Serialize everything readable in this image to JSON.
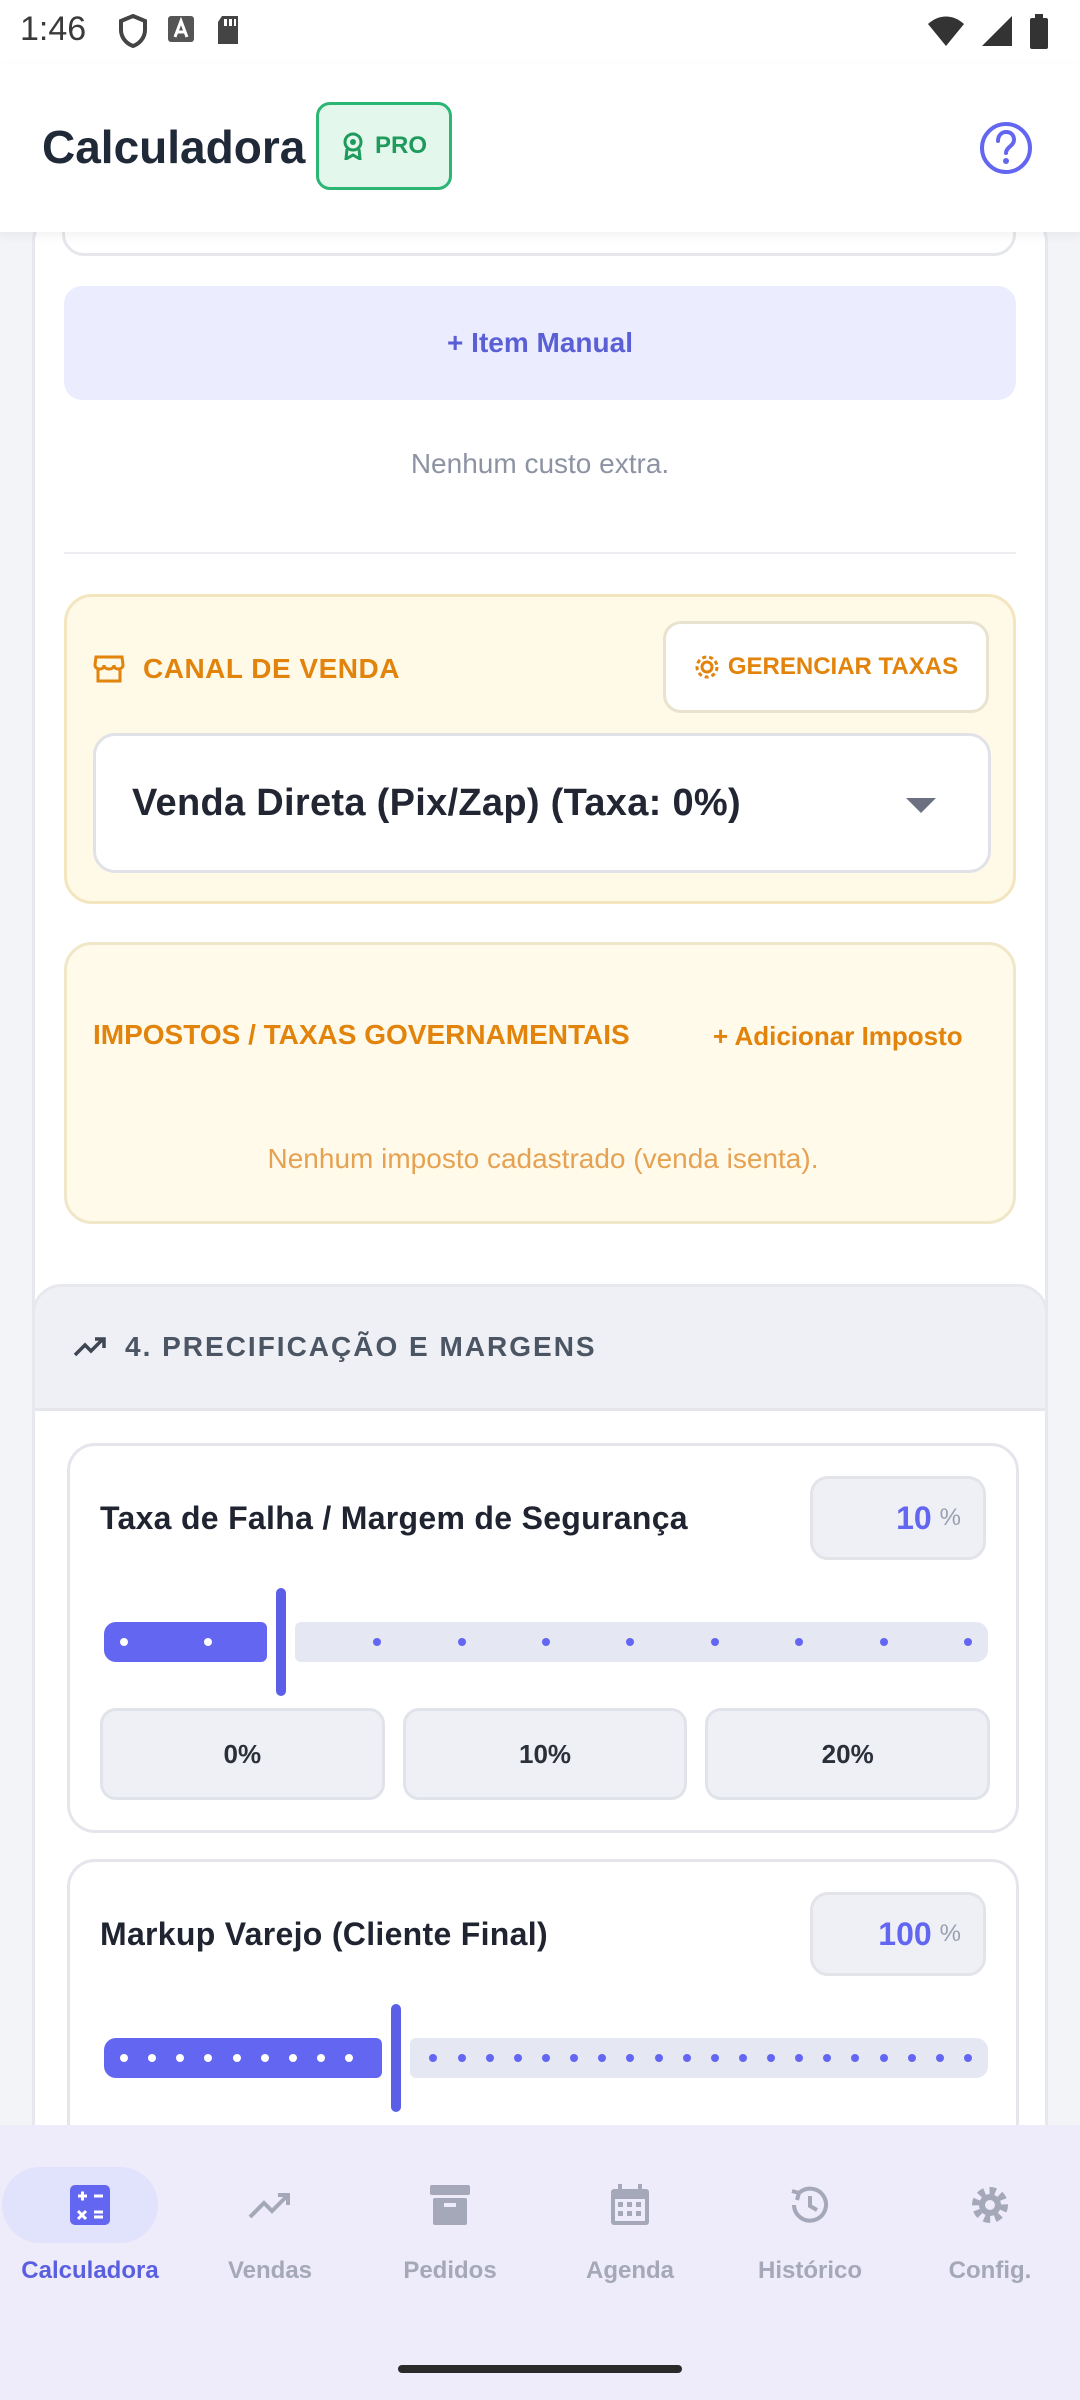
{
  "status_bar": {
    "time": "1:46"
  },
  "header": {
    "title": "Calculadora",
    "badge": "PRO",
    "help_icon": "help-circle-icon"
  },
  "extra_costs": {
    "add_manual_label": "+ Item Manual",
    "empty_text": "Nenhum custo extra."
  },
  "sales_channel": {
    "title": "CANAL DE VENDA",
    "manage_button": "GERENCIAR TAXAS",
    "selected_value": "Venda Direta (Pix/Zap) (Taxa: 0%)"
  },
  "taxes": {
    "title": "IMPOSTOS / TAXAS GOVERNAMENTAIS",
    "add_label": "+ Adicionar Imposto",
    "empty_text": "Nenhum imposto cadastrado (venda isenta)."
  },
  "pricing_section": {
    "title": "4. PRECIFICAÇÃO E MARGENS",
    "failure_rate": {
      "label": "Taxa de Falha / Margem de Segurança",
      "value": "10",
      "unit": "%",
      "slider_fraction": 0.2,
      "presets": [
        "0%",
        "10%",
        "20%"
      ]
    },
    "retail_markup": {
      "label": "Markup Varejo (Cliente Final)",
      "value": "100",
      "unit": "%",
      "slider_fraction": 0.33
    }
  },
  "bottom_nav": {
    "items": [
      {
        "label": "Calculadora",
        "icon": "calculator-icon",
        "active": true
      },
      {
        "label": "Vendas",
        "icon": "trending-up-icon",
        "active": false
      },
      {
        "label": "Pedidos",
        "icon": "archive-box-icon",
        "active": false
      },
      {
        "label": "Agenda",
        "icon": "calendar-icon",
        "active": false
      },
      {
        "label": "Histórico",
        "icon": "history-icon",
        "active": false
      },
      {
        "label": "Config.",
        "icon": "gear-icon",
        "active": false
      }
    ]
  },
  "colors": {
    "accent": "#6366f1",
    "warning": "#e2830b",
    "success": "#2bb673"
  }
}
